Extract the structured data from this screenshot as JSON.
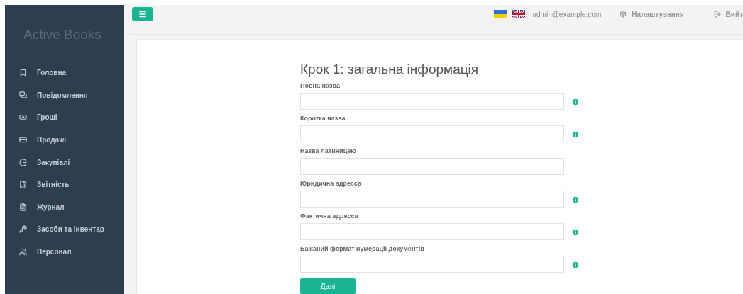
{
  "sidebar": {
    "brand": "Active Books",
    "items": [
      {
        "label": "Головна"
      },
      {
        "label": "Повідомлення"
      },
      {
        "label": "Гроші"
      },
      {
        "label": "Продажі"
      },
      {
        "label": "Закупівлі"
      },
      {
        "label": "Звітність"
      },
      {
        "label": "Журнал"
      },
      {
        "label": "Засоби та інвентар"
      },
      {
        "label": "Персонал"
      }
    ]
  },
  "topbar": {
    "user": "admin@example.com",
    "settings": "Налаштування",
    "logout": "Вийт"
  },
  "form": {
    "title": "Крок 1: загальна інформація",
    "fields": [
      {
        "label": "Повна назва",
        "info": true
      },
      {
        "label": "Коротка назва",
        "info": true
      },
      {
        "label": "Назва латиницею",
        "info": false
      },
      {
        "label": "Юридична адресса",
        "info": true
      },
      {
        "label": "Фактична адресса",
        "info": true
      },
      {
        "label": "Бажаний формат нумерації документів",
        "info": true
      }
    ],
    "next_button": "Далі"
  }
}
